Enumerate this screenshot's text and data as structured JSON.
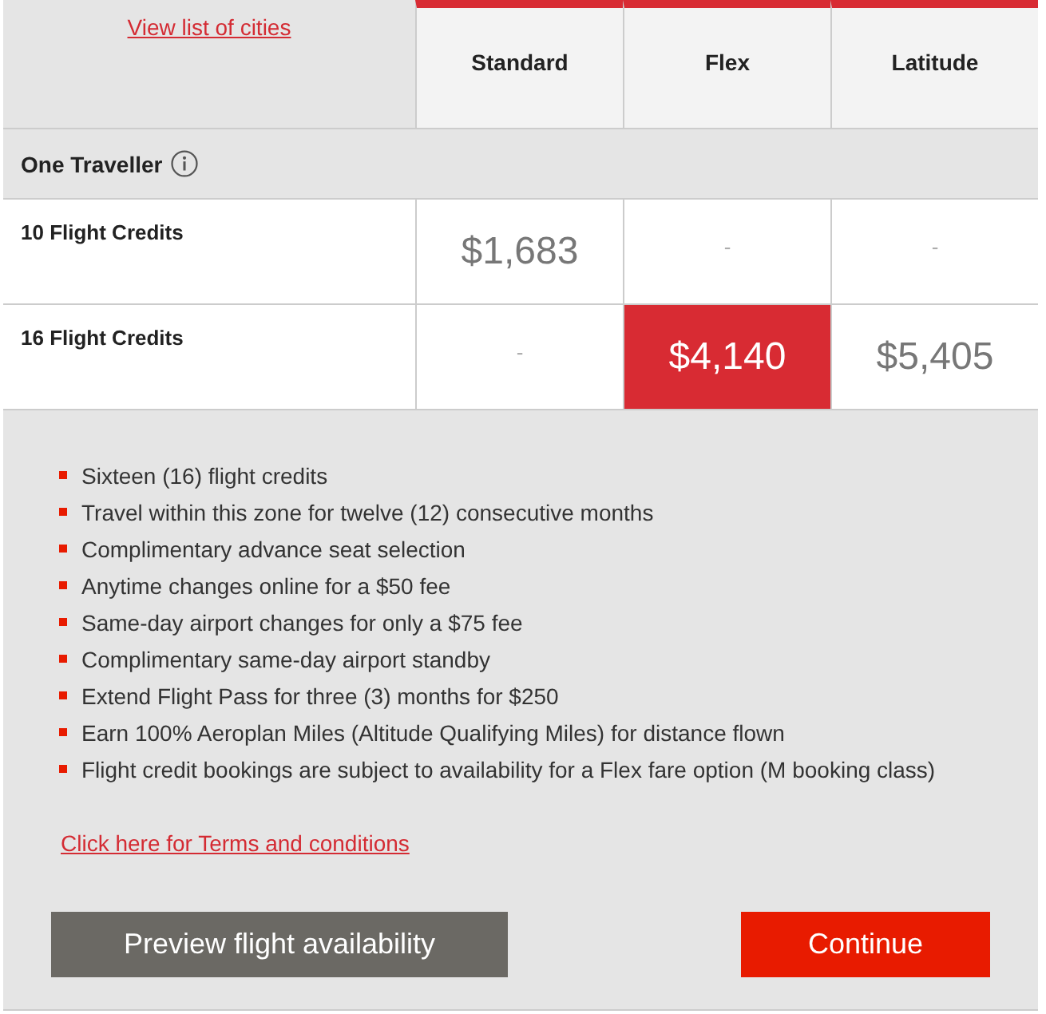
{
  "header": {
    "link": "View list of cities",
    "fares": [
      {
        "name": "Standard"
      },
      {
        "name": "Flex"
      },
      {
        "name": "Latitude"
      }
    ]
  },
  "group": {
    "label": "One Traveller"
  },
  "rows": [
    {
      "label": "10 Flight Credits",
      "prices": [
        {
          "text": "$1,683",
          "kind": "price",
          "selected": false
        },
        {
          "text": "-",
          "kind": "empty",
          "selected": false
        },
        {
          "text": "-",
          "kind": "empty",
          "selected": false
        }
      ]
    },
    {
      "label": "16 Flight Credits",
      "prices": [
        {
          "text": "-",
          "kind": "empty",
          "selected": false
        },
        {
          "text": "$4,140",
          "kind": "price",
          "selected": true
        },
        {
          "text": "$5,405",
          "kind": "price",
          "selected": false
        }
      ]
    }
  ],
  "features": [
    "Sixteen (16) flight credits",
    "Travel within this zone for twelve (12) consecutive months",
    "Complimentary advance seat selection",
    "Anytime changes online for a $50 fee",
    "Same-day airport changes for only a $75 fee",
    "Complimentary same-day airport standby",
    "Extend Flight Pass for three (3) months for $250",
    "Earn 100% Aeroplan Miles (Altitude Qualifying Miles) for distance flown",
    "Flight credit bookings are subject to availability for a Flex fare option (M booking class)"
  ],
  "terms_link": "Click here for Terms and conditions",
  "buttons": [
    {
      "label": "Preview flight availability",
      "kind": "secondary"
    },
    {
      "label": "Continue",
      "kind": "primary"
    }
  ]
}
